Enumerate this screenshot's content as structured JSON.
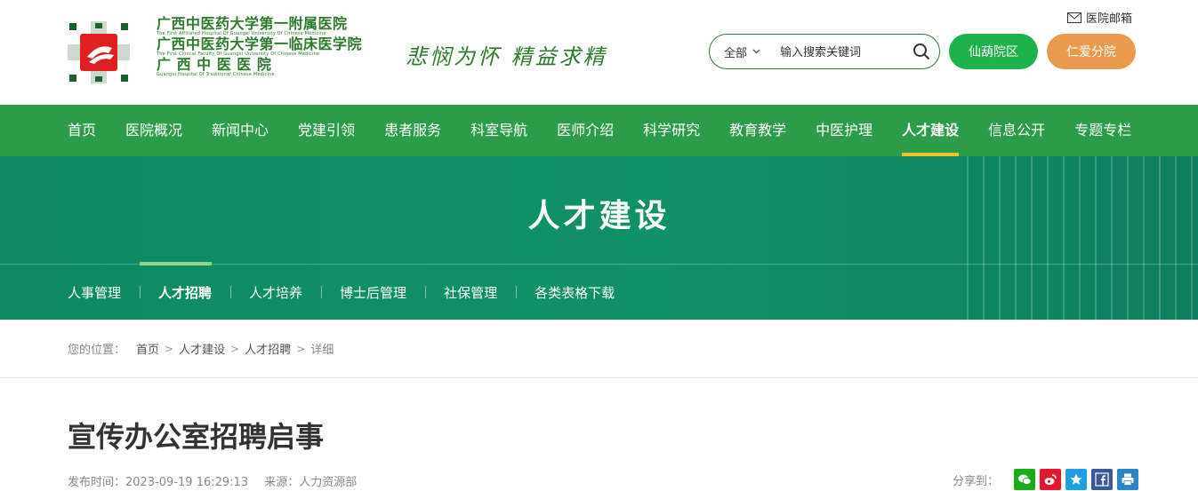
{
  "header": {
    "logo_lines": [
      "广西中医药大学第一附属医院",
      "The First Affiliated Hospital Of Guangxi University Of Chinese Medicine",
      "广西中医药大学第一临床医学院",
      "The First Clinical Faculty Of Guangxi University Of Chinese Medicine",
      "广 西 中 医 医 院",
      "Guangxi Hospital Of Traditional Chinese Medicine"
    ],
    "motto": "悲悯为怀 精益求精",
    "mail_label": "医院邮箱",
    "search": {
      "scope": "全部",
      "placeholder": "输入搜索关键词"
    },
    "campus_buttons": [
      "仙葫院区",
      "仁爱分院"
    ]
  },
  "nav": {
    "items": [
      "首页",
      "医院概况",
      "新闻中心",
      "党建引领",
      "患者服务",
      "科室导航",
      "医师介绍",
      "科学研究",
      "教育教学",
      "中医护理",
      "人才建设",
      "信息公开",
      "专题专栏"
    ],
    "active": "人才建设"
  },
  "banner": {
    "title": "人才建设",
    "subnav": [
      "人事管理",
      "人才招聘",
      "人才培养",
      "博士后管理",
      "社保管理",
      "各类表格下载"
    ],
    "active": "人才招聘"
  },
  "breadcrumb": {
    "label": "您的位置：",
    "items": [
      "首页",
      "人才建设",
      "人才招聘",
      "详细"
    ]
  },
  "article": {
    "title": "宣传办公室招聘启事",
    "publish_label": "发布时间：",
    "publish_time": "2023-09-19 16:29:13",
    "source_label": "来源：",
    "source": "人力资源部",
    "share_label": "分享到："
  },
  "colors": {
    "brand_green": "#2d9c4a",
    "banner_green": "#119168",
    "nav_underline": "#f2c22e",
    "btn_green": "#1fb14c",
    "btn_orange": "#e89a4f"
  },
  "icons": [
    "mail-icon",
    "chevron-down-icon",
    "search-icon",
    "wechat-icon",
    "weibo-icon",
    "qzone-icon",
    "facebook-icon",
    "print-icon"
  ]
}
